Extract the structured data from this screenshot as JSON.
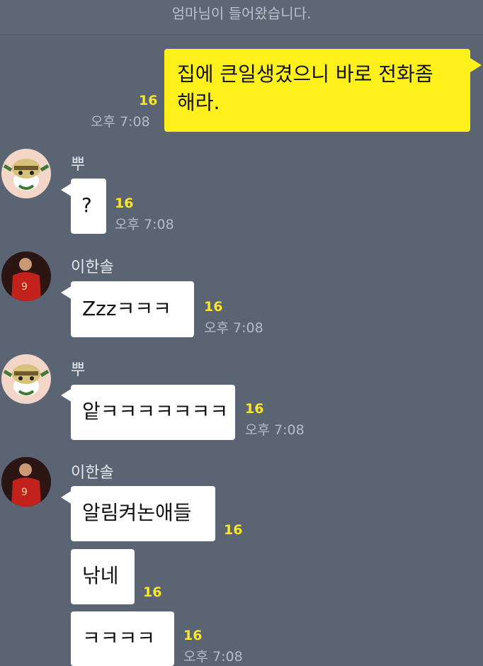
{
  "system_notice": "엄마님이 들어왔습니다.",
  "messages": [
    {
      "sender": "",
      "text_line1": "집에 큰일생겼으니 바로 전화좀",
      "text_line2": "해라.",
      "count": "16",
      "time": "오후 7:08"
    },
    {
      "sender": "뿌",
      "text": "?",
      "count": "16",
      "time": "오후 7:08"
    },
    {
      "sender": "이한솔",
      "text": "Zzzㅋㅋㅋ",
      "count": "16",
      "time": "오후 7:08"
    },
    {
      "sender": "뿌",
      "text": "앝ㅋㅋㅋㅋㅋㅋㅋ",
      "count": "16",
      "time": "오후 7:08"
    },
    {
      "sender": "이한솔",
      "text": "알림켜논애들",
      "count": "16"
    },
    {
      "sender": "",
      "text": "낚네",
      "count": "16"
    },
    {
      "sender": "",
      "text": "ㅋㅋㅋㅋ",
      "count": "16",
      "time": "오후 7:08"
    }
  ],
  "colors": {
    "background": "#5b6473",
    "my_bubble": "#fef01b",
    "other_bubble": "#ffffff",
    "unread_count": "#fbe62a"
  }
}
